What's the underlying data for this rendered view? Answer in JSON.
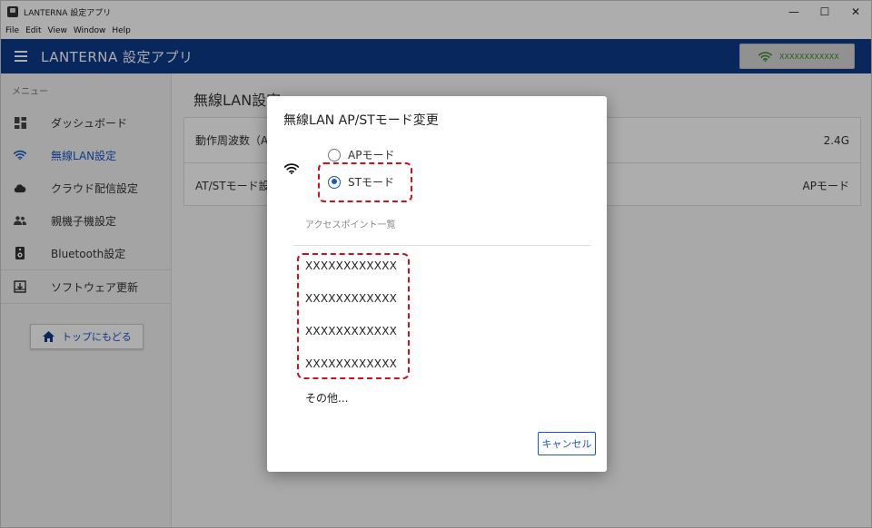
{
  "window": {
    "title": "LANTERNA 設定アプリ",
    "controls": {
      "minimize": "—",
      "maximize": "☐",
      "close": "✕"
    }
  },
  "menubar": [
    "File",
    "Edit",
    "View",
    "Window",
    "Help"
  ],
  "appbar": {
    "title": "LANTERNA 設定アプリ",
    "wifi_ssid": "XXXXXXXXXXXX",
    "wifi_color": "#3a8a2a",
    "bg_color": "#0d3a8a"
  },
  "sidebar": {
    "header": "メニュー",
    "items": [
      {
        "label": "ダッシュボード",
        "icon": "dashboard-icon"
      },
      {
        "label": "無線LAN設定",
        "icon": "wifi-icon",
        "active": true
      },
      {
        "label": "クラウド配信設定",
        "icon": "cloud-icon"
      },
      {
        "label": "親機子機設定",
        "icon": "people-icon"
      },
      {
        "label": "Bluetooth設定",
        "icon": "speaker-icon"
      },
      {
        "label": "ソフトウェア更新",
        "icon": "download-icon"
      }
    ],
    "home_button": "トップにもどる"
  },
  "main": {
    "title": "無線LAN設定",
    "rows": [
      {
        "label": "動作周波数（A",
        "value": "2.4G"
      },
      {
        "label": "AT/STモード設",
        "value": "APモード"
      }
    ]
  },
  "dialog": {
    "title": "無線LAN AP/STモード変更",
    "modes": [
      {
        "label": "APモード",
        "checked": false
      },
      {
        "label": "STモード",
        "checked": true
      }
    ],
    "ap_list_heading": "アクセスポイント一覧",
    "access_points": [
      "XXXXXXXXXXXX",
      "XXXXXXXXXXXX",
      "XXXXXXXXXXXX",
      "XXXXXXXXXXXX"
    ],
    "other": "その他...",
    "cancel_label": "キャンセル"
  }
}
